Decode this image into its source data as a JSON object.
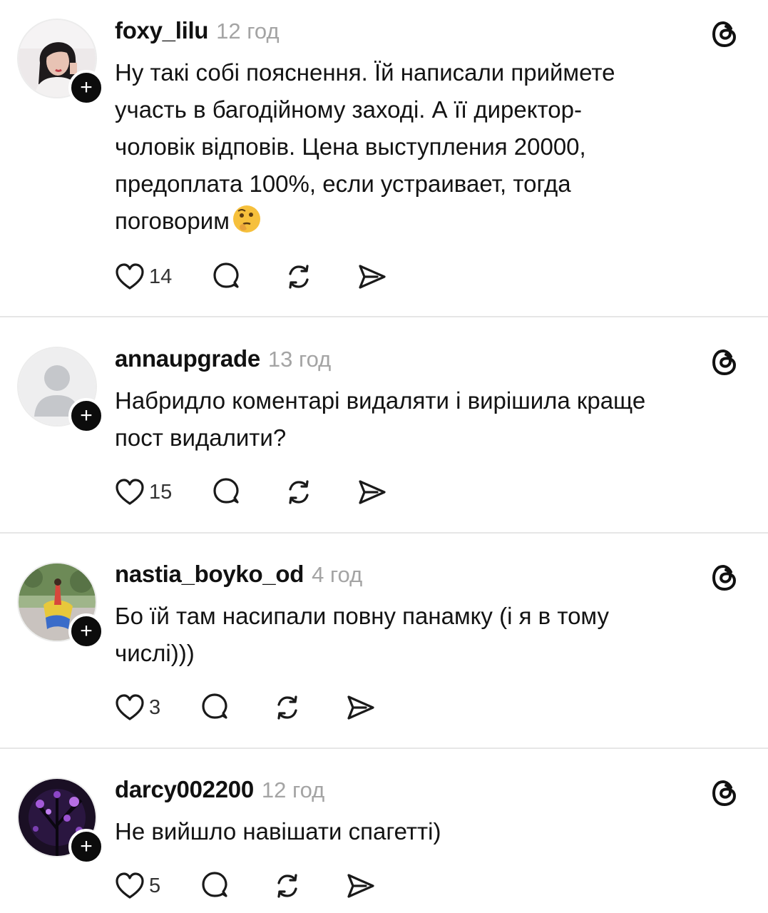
{
  "posts": [
    {
      "username": "foxy_lilu",
      "time": "12 год",
      "text_lines": [
        "Ну такі собі пояснення. Їй написали приймете",
        "участь в багодійному заході. А її директор-",
        "чоловік відповів. Цена выступления 20000,",
        "предоплата 100%, если устраивает, тогда",
        "поговорим"
      ],
      "emoji": "thinking-face",
      "likes": "14",
      "avatar": "woman-dark-hair"
    },
    {
      "username": "annaupgrade",
      "time": "13 год",
      "text_lines": [
        "Набридло коментарі видаляти і вирішила краще",
        "пост видалити?"
      ],
      "likes": "15",
      "avatar": "default-person"
    },
    {
      "username": "nastia_boyko_od",
      "time": "4 год",
      "text_lines": [
        "Бо їй там насипали повну панамку (і я в тому",
        "числі)))"
      ],
      "likes": "3",
      "avatar": "girl-with-flag"
    },
    {
      "username": "darcy002200",
      "time": "12 год",
      "text_lines": [
        "Не вийшло навішати спагетті)"
      ],
      "likes": "5",
      "avatar": "purple-tree-night"
    }
  ],
  "colors": {
    "text": "#131313",
    "muted": "#a4a4a4",
    "divider": "#e6e6e6",
    "follow_badge": "#0c0c0c"
  },
  "icons": [
    "heart-icon",
    "comment-icon",
    "repost-icon",
    "share-icon",
    "threads-icon",
    "plus-icon"
  ]
}
